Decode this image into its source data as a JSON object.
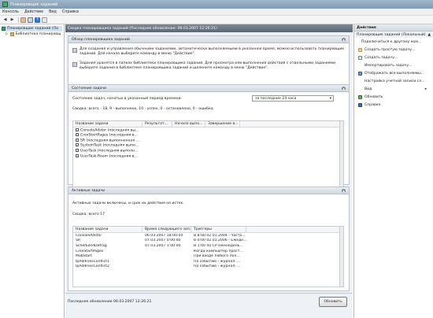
{
  "window": {
    "title": "Планировщик заданий"
  },
  "menu": [
    "Консоль",
    "Действие",
    "Вид",
    "Справка"
  ],
  "tree": {
    "root": "Планировщик заданий (Ло",
    "child": "Библиотека планировщ"
  },
  "main": {
    "header": "Сводка планировщика заданий (Последнее обновление: 06.03.2007 12:26:21)",
    "overview": {
      "title": "Обзор планировщика заданий",
      "para1": "Для создания и управления обычными заданиями, автоматически выполняемыми в указанное время, можно использовать планировщик заданий. Для начала выберите команду в меню \"Действие\".",
      "para2": "Задания хранятся в папках библиотеки планировщика заданий. Для просмотра или выполнения действия с отдельными заданиями выберите задание в библиотеке планировщика заданий и щелкните команду в меню \"Действие\"."
    },
    "status": {
      "title": "Состояние задачи",
      "period_label": "Состояние задач, начатых в указанный период времени:",
      "period_value": "за последние 24 часа",
      "summary": "Сводка: всего - 18, 9 - выполнено, 10 - успех, 0 - остановлено, 0 - ошибка",
      "columns": [
        "Название задачи",
        "Результат...",
        "Начало выпо...",
        "Завершение в..."
      ],
      "rows": [
        "ConsoleAdstor (последняя вы...",
        "CrexStartPages (последняя в...",
        "SR (последняя выполненная ...",
        "SystemTask (последняя выпо...",
        "UserTask (последняя выполн...",
        "UserTask-Roam (последняя в..."
      ]
    },
    "active": {
      "title": "Активные задачи",
      "desc": "Активные задачи включены, и срок их действия не истек.",
      "summary": "Сводка: всего 17",
      "columns": [
        "Название задачи",
        "Время следующего зап...",
        "Триггеры"
      ],
      "rows": [
        [
          "ConsoleAdstor",
          "06.03.2007 18:00:00",
          "В 8:00 02.01.2004 - Часто..."
        ],
        [
          "SR",
          "07.03.2007 0:00:00",
          "В 0:00 02.01.2006 - Ежедн..."
        ],
        [
          "ScheduledDefrag",
          "07.03.2007 1:00:00",
          "В 1:00 по СР еженедель..."
        ],
        [
          "CrexStartPages",
          "",
          "Когда компьютер прост..."
        ],
        [
          "MobStart",
          "",
          "При входе любого пол..."
        ],
        [
          "IpAddressConflict1",
          "",
          "По событию - журнал: ..."
        ],
        [
          "IpAddressConflict2",
          "",
          "По событию - журнал: ..."
        ]
      ]
    },
    "footer": {
      "last_update": "Последнее обновление 06.03.2007 12:26:21",
      "refresh": "Обновить"
    }
  },
  "actions": {
    "title": "Действия",
    "section": "Планировщик заданий (Локальный)",
    "items": [
      "Подключиться к другому ком...",
      "Создать простую задачу...",
      "Создать задачу...",
      "Импортировать задачу...",
      "Отображать все выполняемы...",
      "Настройка учетной записи сл...",
      "Вид",
      "Обновить",
      "Справка"
    ]
  }
}
